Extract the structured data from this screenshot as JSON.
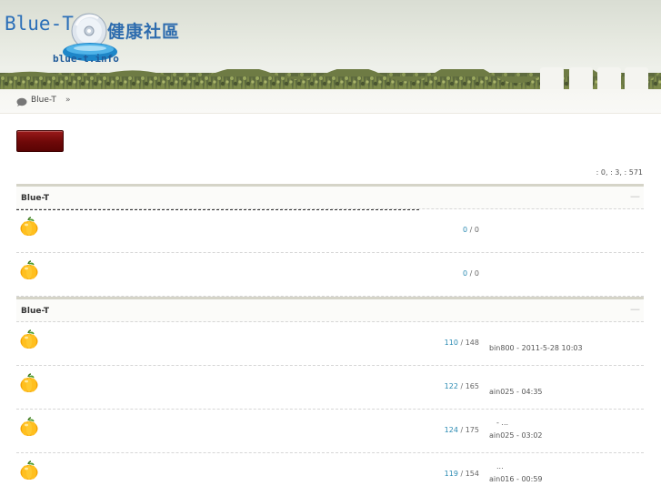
{
  "header": {
    "logo_text": "Blue-T",
    "logo_cn": "健康社區",
    "logo_url": "blue-t.info",
    "nav_tabs": [
      "",
      "",
      "",
      ""
    ]
  },
  "breadcrumb": {
    "home": "Blue-T",
    "separator": "»"
  },
  "new_post": {
    "label": ""
  },
  "stats": {
    "text": ": 0,  : 3,  : 571"
  },
  "groups": [
    {
      "title": "Blue-T",
      "collapse": "—",
      "forums": [
        {
          "topics": "0",
          "posts": "0",
          "last_line1": "",
          "last_line2": ""
        },
        {
          "topics": "0",
          "posts": "0",
          "last_line1": "",
          "last_line2": ""
        }
      ]
    },
    {
      "title": "Blue-T",
      "collapse": "—",
      "forums": [
        {
          "topics": "110",
          "posts": "148",
          "last_line1": "",
          "last_line2": "bin800 - 2011-5-28 10:03"
        },
        {
          "topics": "122",
          "posts": "165",
          "last_line1": "",
          "last_line2": "ain025 -    04:35"
        },
        {
          "topics": "124",
          "posts": "175",
          "last_line1": "-          ...",
          "last_line2": "ain025 -    03:02"
        },
        {
          "topics": "119",
          "posts": "154",
          "last_line1": "...",
          "last_line2": "ain016 -    00:59"
        }
      ]
    }
  ],
  "colors": {
    "accent_blue": "#2a8ab2",
    "button_red": "#7a0c0c",
    "group_border": "#d5d4c8"
  },
  "icons": [
    "pumpkin-forum-icon",
    "speech-bubble-icon",
    "disc-logo-icon"
  ]
}
